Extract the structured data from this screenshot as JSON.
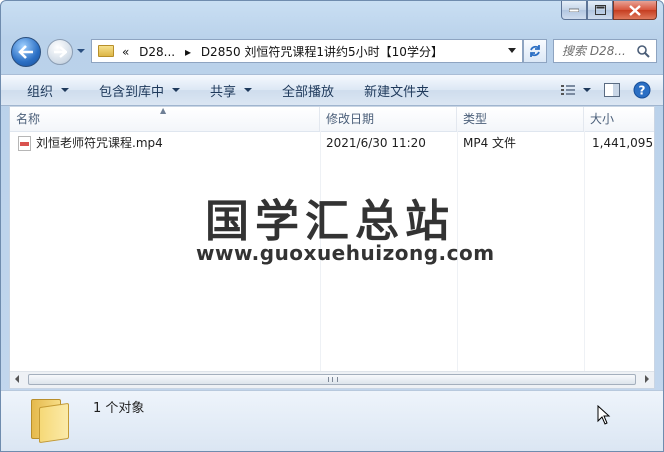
{
  "window": {
    "minimize_icon": "minimize-icon",
    "maximize_icon": "maximize-icon",
    "close_icon": "close-icon"
  },
  "address_bar": {
    "overflow": "«",
    "segments": [
      "D28...",
      "D2850 刘恒符咒课程1讲约5小时【10学分】"
    ],
    "separator": "▸"
  },
  "search": {
    "placeholder": "搜索 D28..."
  },
  "toolbar": {
    "organize": "组织",
    "include_in_library": "包含到库中",
    "share": "共享",
    "play_all": "全部播放",
    "new_folder": "新建文件夹"
  },
  "columns": {
    "name": "名称",
    "date_modified": "修改日期",
    "type": "类型",
    "size": "大小"
  },
  "files": [
    {
      "name": "刘恒老师符咒课程.mp4",
      "date_modified": "2021/6/30 11:20",
      "type": "MP4 文件",
      "size": "1,441,095..."
    }
  ],
  "watermark": {
    "title": "国学汇总站",
    "url": "www.guoxuehuizong.com"
  },
  "status": {
    "count": "1 个对象"
  },
  "colors": {
    "accent": "#2b6fc4",
    "close": "#d7543b"
  }
}
